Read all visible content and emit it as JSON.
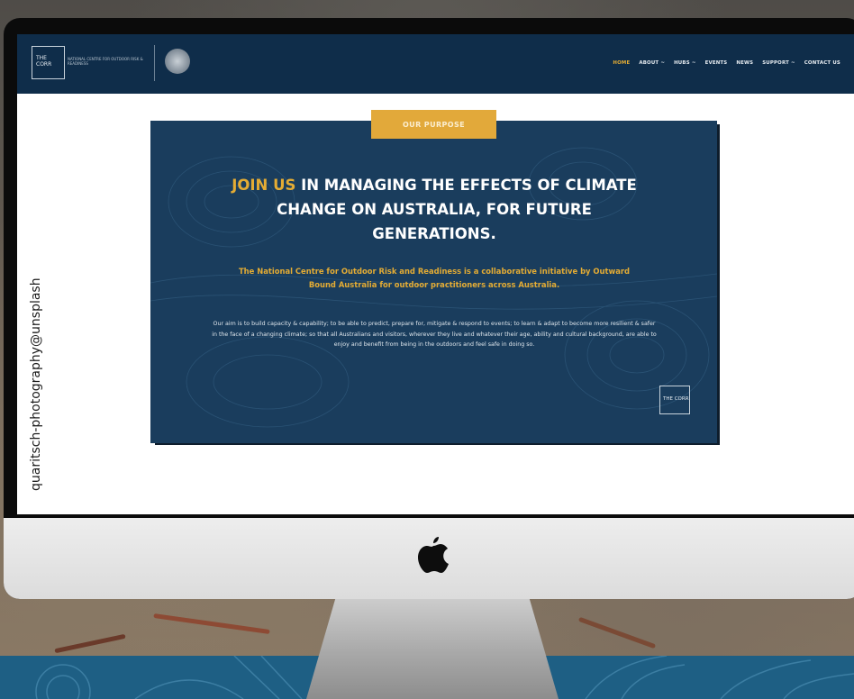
{
  "photo_credit": "quaritsch-photography@unsplash",
  "site": {
    "logo_text": "THE CORR",
    "logo_tagline": "NATIONAL CENTRE FOR OUTDOOR RISK & READINESS",
    "nav": [
      "HOME",
      "ABOUT ~",
      "HUBS ~",
      "EVENTS",
      "NEWS",
      "SUPPORT ~",
      "CONTACT US"
    ]
  },
  "purpose_button": "OUR PURPOSE",
  "headline": {
    "highlight": "JOIN US",
    "rest": " IN MANAGING THE EFFECTS OF CLIMATE CHANGE ON AUSTRALIA, FOR FUTURE GENERATIONS."
  },
  "intro": "The National Centre for Outdoor Risk and Readiness is a collaborative initiative by Outward Bound Australia for outdoor practitioners across Australia.",
  "body": "Our aim is to build capacity & capability; to be able to predict, prepare for, mitigate & respond to events; to learn & adapt to become more resilient & safer in the face of a changing climate; so that all Australians and visitors, wherever they live and whatever their age, ability and cultural background, are able to enjoy and benefit from being in the outdoors and feel safe in doing so.",
  "corner_logo": "THE CORR",
  "colors": {
    "navy": "#0f2d4a",
    "panel": "#1a3d5d",
    "gold": "#e2a93a",
    "band": "#1e5f84"
  },
  "icons": [
    "apple-logo-icon",
    "seal-icon"
  ]
}
